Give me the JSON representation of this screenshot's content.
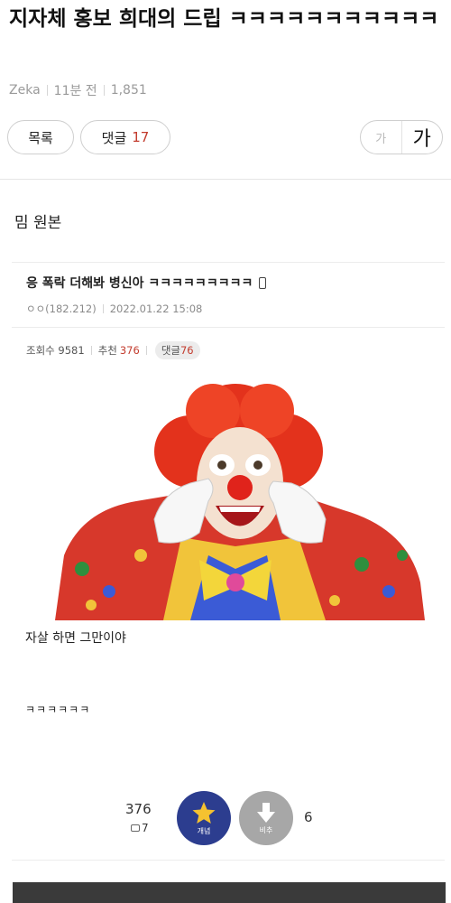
{
  "article": {
    "title": "지자체 홍보 희대의 드립 ㅋㅋㅋㅋㅋㅋㅋㅋㅋㅋㅋ",
    "author": "Zeka",
    "time": "11분 전",
    "views": "1,851"
  },
  "buttons": {
    "list_label": "목록",
    "comment_label": "댓글",
    "comment_count": "17",
    "font_small": "가",
    "font_large": "가"
  },
  "body": {
    "intro": "밈 원본"
  },
  "screenshot": {
    "post_title": "응 폭락 더해봐 병신아 ㅋㅋㅋㅋㅋㅋㅋㅋㅋ",
    "author": "ㅇㅇ(182.212)",
    "date": "2022.01.22 15:08",
    "views_label": "조회수",
    "views": "9581",
    "recommend_label": "추천",
    "recommend": "376",
    "comments_label": "댓글",
    "comments": "76",
    "line1": "자살 하면 그만이야",
    "line2": "ㅋㅋㅋㅋㅋㅋ",
    "like_count": "376",
    "reply_count": "7",
    "up_label": "개념",
    "down_label": "비추",
    "dislike_count": "6",
    "icons": [
      "phone-icon",
      "star-icon",
      "down-arrow-icon",
      "speech-bubble-icon"
    ],
    "colors": {
      "accent_red": "#c33c2e",
      "up_button": "#2c3d8f",
      "down_button": "#a7a7a7",
      "star": "#f5c230"
    }
  }
}
